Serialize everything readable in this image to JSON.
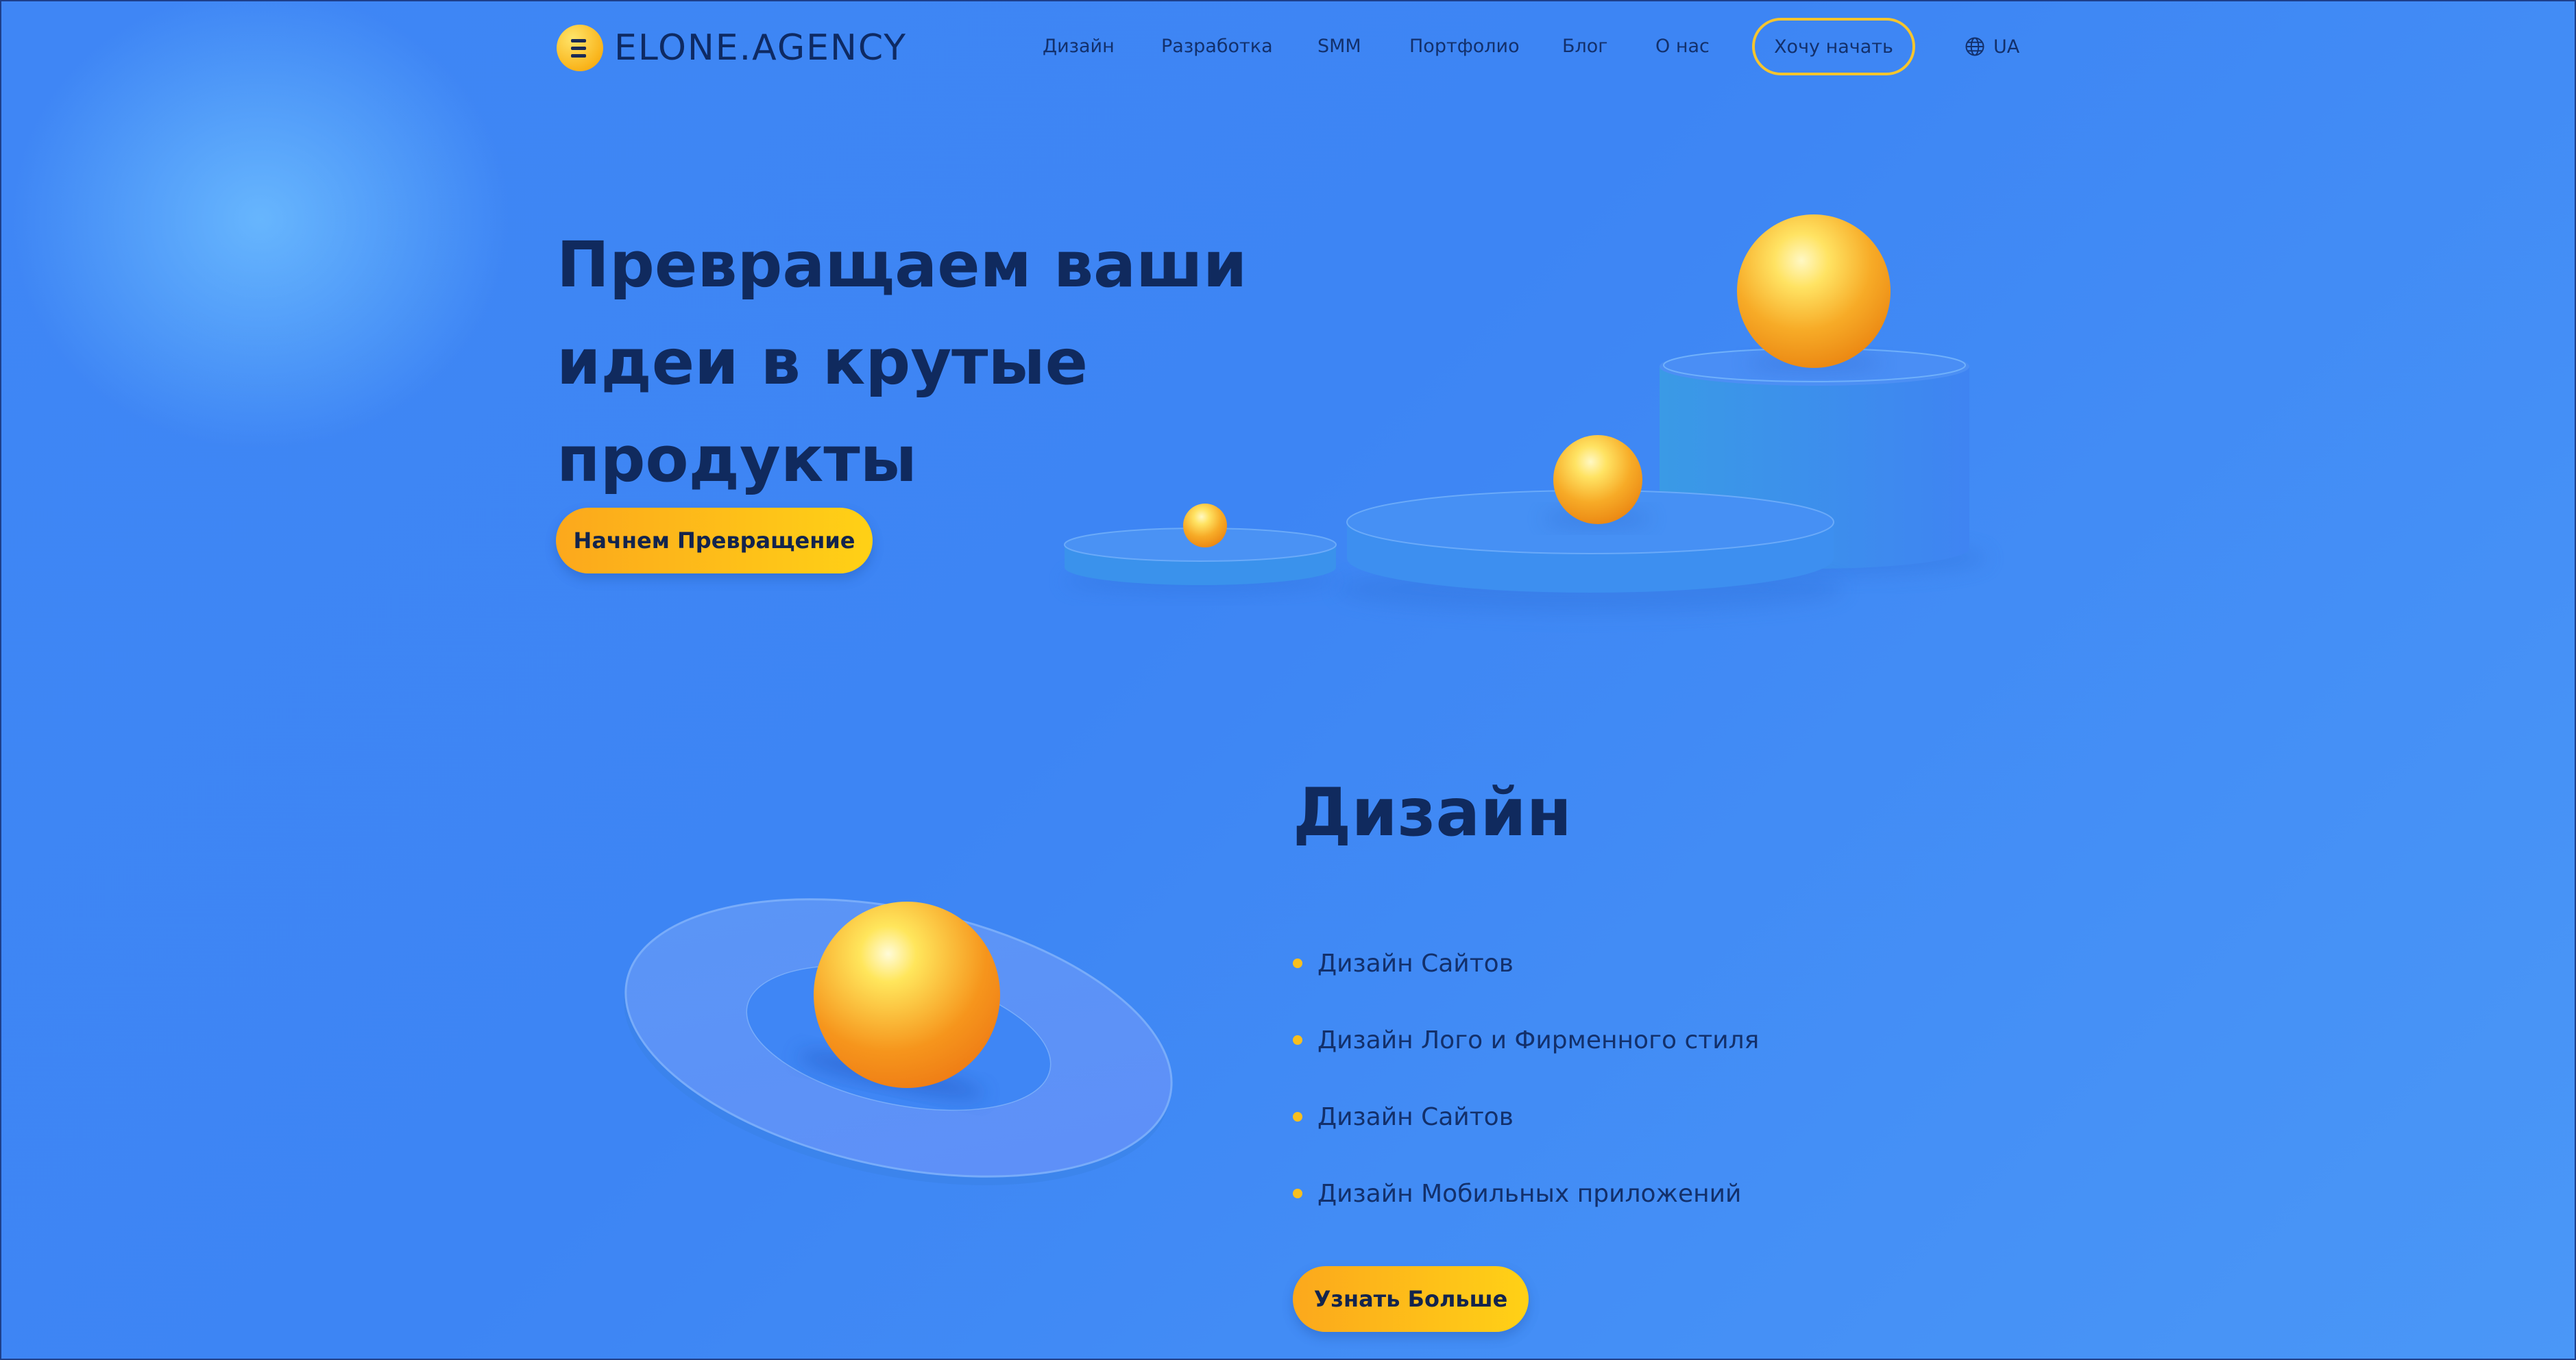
{
  "header": {
    "logo_text": "ELONE.AGENCY",
    "nav": [
      "Дизайн",
      "Разработка",
      "SMM",
      "Портфолио",
      "Блог",
      "О нас"
    ],
    "cta_label": "Хочу начать",
    "lang_label": "UA"
  },
  "hero": {
    "title": "Превращаем ваши идеи в крутые продукты",
    "button_label": "Начнем Превращение"
  },
  "design_section": {
    "title": "Дизайн",
    "items": [
      "Дизайн Сайтов",
      "Дизайн Лого и Фирменного стиля",
      "Дизайн Сайтов",
      "Дизайн Мобильных приложений"
    ],
    "button_label": "Узнать Больше"
  },
  "colors": {
    "background": "#3f86f5",
    "accent_yellow": "#ffc21c",
    "text_dark": "#102a5e"
  },
  "icons": [
    "globe-icon"
  ]
}
